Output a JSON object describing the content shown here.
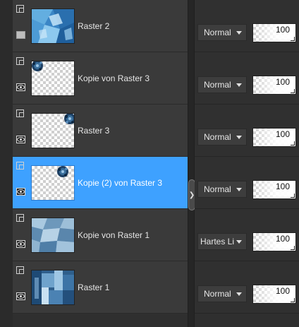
{
  "layers": [
    {
      "name": "Raster 2",
      "visible": false,
      "selected": false,
      "thumbnail": "blue-shards-full"
    },
    {
      "name": "Kopie von Raster 3",
      "visible": true,
      "selected": false,
      "thumbnail": "flower-top-left"
    },
    {
      "name": "Raster 3",
      "visible": true,
      "selected": false,
      "thumbnail": "flower-top-right"
    },
    {
      "name": "Kopie (2) von Raster 3",
      "visible": true,
      "selected": true,
      "thumbnail": "flower-top-center"
    },
    {
      "name": "Kopie von Raster 1",
      "visible": true,
      "selected": false,
      "thumbnail": "blue-tiles-full"
    },
    {
      "name": "Raster 1",
      "visible": true,
      "selected": false,
      "thumbnail": "blue-blocks-full"
    }
  ],
  "properties": [
    {
      "blend_mode": "Normal",
      "opacity": "100"
    },
    {
      "blend_mode": "Normal",
      "opacity": "100"
    },
    {
      "blend_mode": "Normal",
      "opacity": "100"
    },
    {
      "blend_mode": "Normal",
      "opacity": "100"
    },
    {
      "blend_mode": "Hartes Licht",
      "opacity": "100"
    },
    {
      "blend_mode": "Normal",
      "opacity": "100"
    }
  ],
  "icons": {
    "group": "layer-group-icon",
    "visibility": "eye-icon",
    "dropdown": "dropdown-arrow-icon",
    "splitter": "chevron-right-icon"
  },
  "colors": {
    "selection": "#3ea1ff",
    "row_background": "#3a3a3a",
    "panel_background": "#2f2f2f"
  }
}
